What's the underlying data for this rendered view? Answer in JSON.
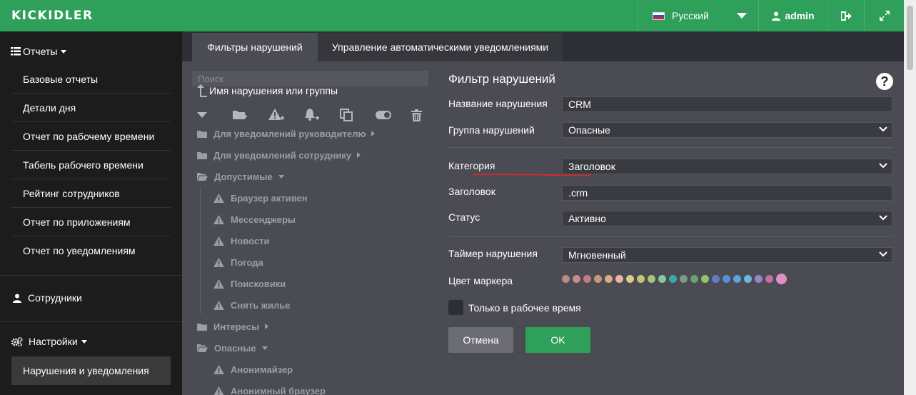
{
  "header": {
    "logo": "KICKIDLER",
    "language": "Русский",
    "user": "admin"
  },
  "sidebar": {
    "reports_title": "Отчеты",
    "report_items": [
      "Базовые отчеты",
      "Детали дня",
      "Отчет по рабочему времени",
      "Табель рабочего времени",
      "Рейтинг сотрудников",
      "Отчет по приложениям",
      "Отчет по уведомлениям"
    ],
    "employees_title": "Сотрудники",
    "settings_title": "Настройки",
    "settings_items": [
      "Нарушения и уведомления"
    ]
  },
  "tabs": [
    {
      "label": "Фильтры нарушений",
      "active": true
    },
    {
      "label": "Управление автоматическими уведомлениями",
      "active": false
    }
  ],
  "tree": {
    "search_placeholder": "Поиск",
    "header": "Имя нарушения или группы",
    "rows": [
      {
        "label": "Для уведомлений руководителю",
        "type": "folder",
        "state": "collapsed"
      },
      {
        "label": "Для уведомлений сотруднику",
        "type": "folder",
        "state": "collapsed"
      },
      {
        "label": "Допустимые",
        "type": "folder-open",
        "state": "expanded"
      },
      {
        "label": "Браузер активен",
        "type": "violation"
      },
      {
        "label": "Мессенджеры",
        "type": "violation"
      },
      {
        "label": "Новости",
        "type": "violation"
      },
      {
        "label": "Погода",
        "type": "violation"
      },
      {
        "label": "Поисковики",
        "type": "violation"
      },
      {
        "label": "Снять жилье",
        "type": "violation"
      },
      {
        "label": "Интересы",
        "type": "folder",
        "state": "collapsed"
      },
      {
        "label": "Опасные",
        "type": "folder-open",
        "state": "expanded"
      },
      {
        "label": "Анонимайзер",
        "type": "violation"
      },
      {
        "label": "Анонимный браузер",
        "type": "violation"
      }
    ]
  },
  "form": {
    "title": "Фильтр нарушений",
    "help": "?",
    "name_label": "Название нарушения",
    "name_value": "CRM",
    "group_label": "Группа нарушений",
    "group_value": "Опасные",
    "category_label": "Категория",
    "category_value": "Заголовок",
    "heading_label": "Заголовок",
    "heading_value": ".crm",
    "status_label": "Статус",
    "status_value": "Активно",
    "timer_label": "Таймер нарушения",
    "timer_value": "Мгновенный",
    "marker_label": "Цвет маркера",
    "marker_colors": [
      "#b98a7e",
      "#c98b8b",
      "#c47a86",
      "#c8957a",
      "#d7ad87",
      "#e9b5a6",
      "#dccb86",
      "#c3c774",
      "#a7c67d",
      "#82c99b",
      "#3aa7a8",
      "#7f9a85",
      "#6b9f74",
      "#93c26d",
      "#5f7ec0",
      "#4f93df",
      "#56a4e0",
      "#6fb7d8",
      "#9a84c5",
      "#c56e9f",
      "#df8fc6"
    ],
    "selected_color_index": 20,
    "workhours_label": "Только в рабочее время",
    "cancel_label": "Отмена",
    "ok_label": "OK"
  },
  "colors": {
    "accent": "#2ea05a",
    "underline": "#e0262a"
  }
}
